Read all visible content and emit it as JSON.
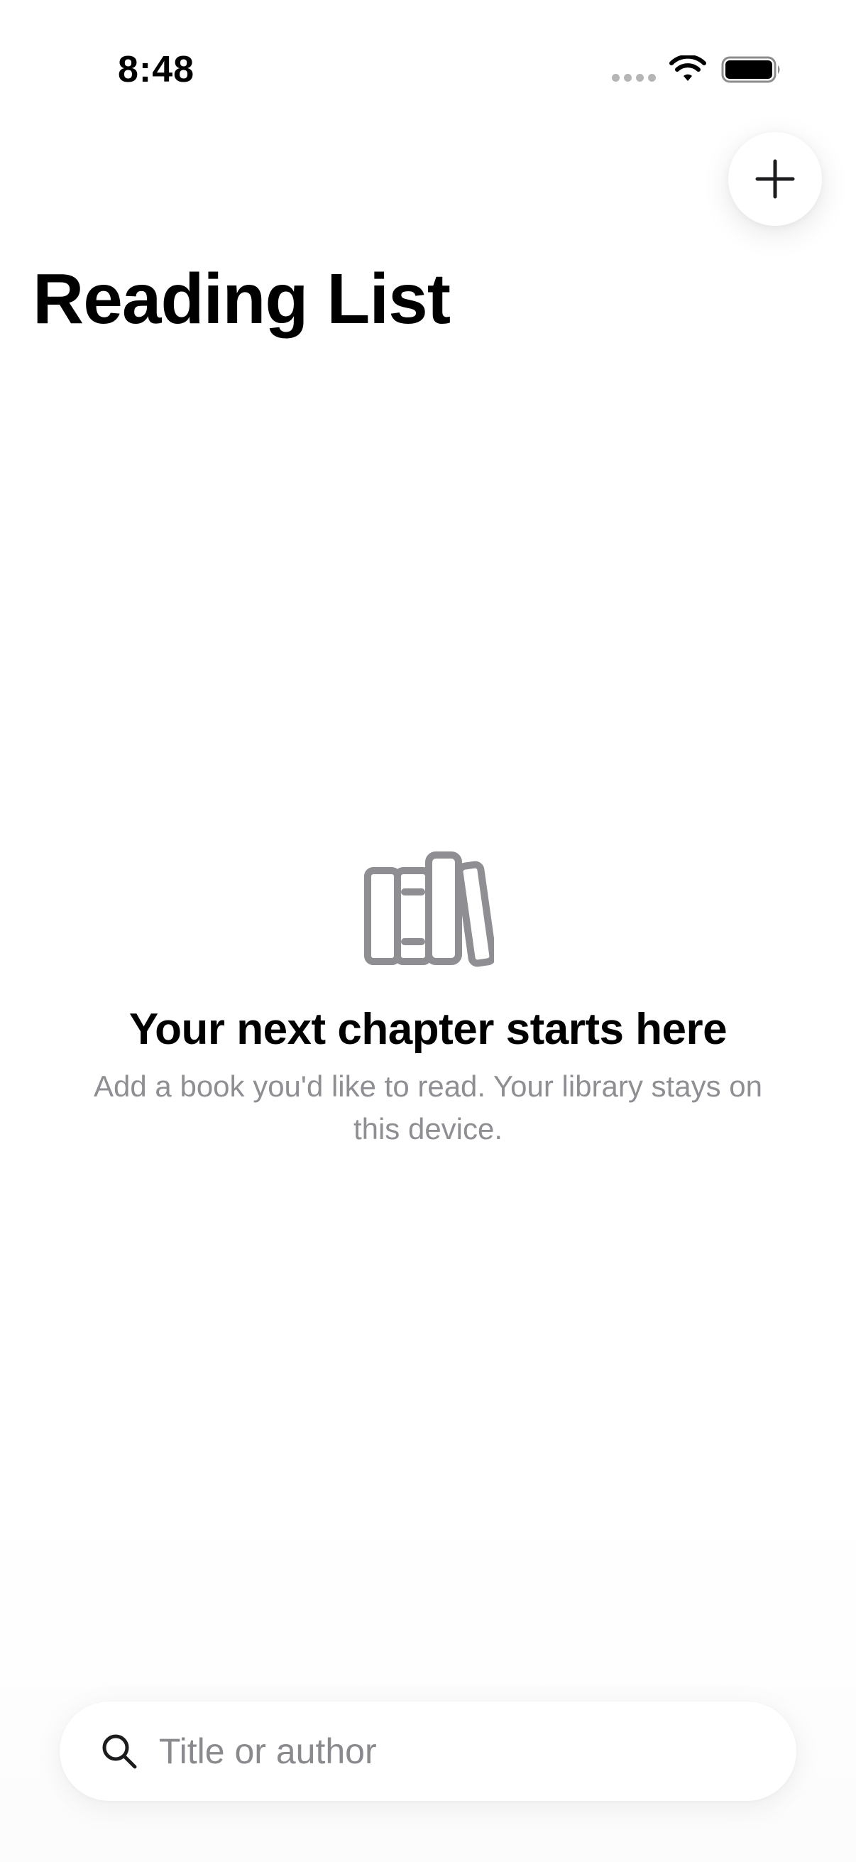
{
  "status_bar": {
    "time": "8:48",
    "icons": [
      "signal-dots-icon",
      "wifi-icon",
      "battery-icon"
    ]
  },
  "header": {
    "title": "Reading List",
    "add_button_icon": "plus-icon"
  },
  "empty_state": {
    "icon": "books-icon",
    "heading": "Your next chapter starts here",
    "body": "Add a book you'd like to read. Your library stays on this device."
  },
  "search": {
    "icon": "search-icon",
    "placeholder": "Title or author",
    "value": ""
  },
  "colors": {
    "background": "#ffffff",
    "text_primary": "#000000",
    "text_secondary": "#8e8e93",
    "icon_gray": "#8e8e93"
  }
}
